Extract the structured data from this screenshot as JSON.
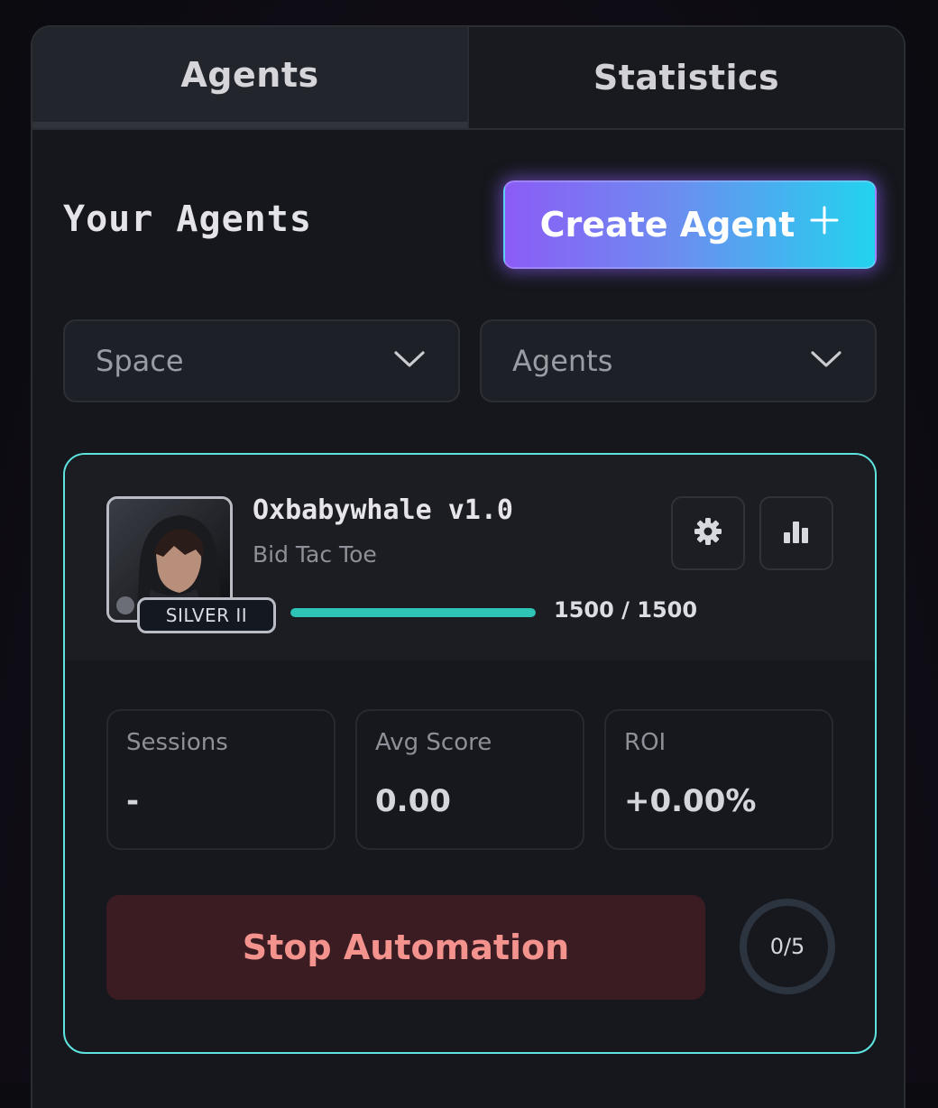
{
  "tabs": [
    {
      "label": "Agents",
      "active": true
    },
    {
      "label": "Statistics",
      "active": false
    }
  ],
  "header": {
    "title": "Your Agents",
    "create_button_label": "Create Agent",
    "create_button_icon": "plus-icon"
  },
  "filters": {
    "space": {
      "value": "Space",
      "icon": "chevron-down-icon"
    },
    "agents": {
      "value": "Agents",
      "icon": "chevron-down-icon"
    }
  },
  "agent_card": {
    "name": "Oxbabywhale v1.0",
    "game": "Bid Tac Toe",
    "rank": "SILVER II",
    "progress_text": "1500 / 1500",
    "progress_fraction": 1.0,
    "icons": {
      "settings": "gear-icon",
      "stats": "bar-chart-icon"
    },
    "stats": [
      {
        "label": "Sessions",
        "value": "-"
      },
      {
        "label": "Avg Score",
        "value": "0.00"
      },
      {
        "label": "ROI",
        "value": "+0.00%"
      }
    ],
    "stop_button_label": "Stop Automation",
    "counter_text": "0/5",
    "counter_fraction": 0
  },
  "colors": {
    "accent_border": "#5fe3df",
    "progress_fill": "#2ec4b6",
    "stop_text": "#f4938e",
    "stop_bg": "#3b1c22",
    "gradient_start": "#8b5cf6",
    "gradient_end": "#22d3ee"
  }
}
